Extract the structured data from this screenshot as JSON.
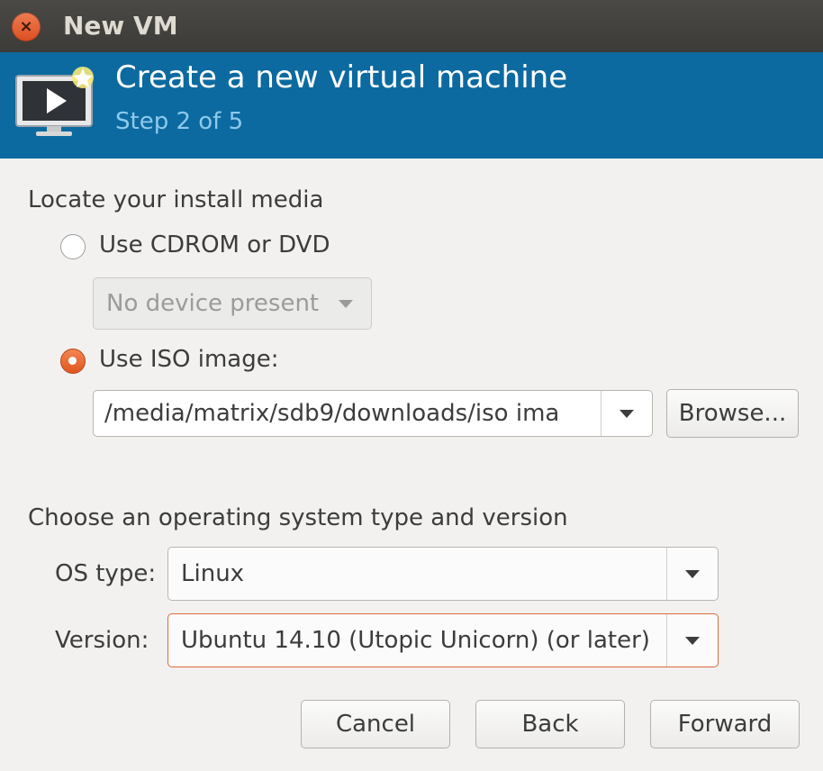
{
  "window": {
    "title": "New VM",
    "close_glyph": "×"
  },
  "header": {
    "title": "Create a new virtual machine",
    "step": "Step 2 of 5",
    "icon": "vm-monitor-icon"
  },
  "install_media": {
    "section_label": "Locate your install media",
    "cdrom": {
      "label": "Use CDROM or DVD",
      "selected": false,
      "device": "No device present"
    },
    "iso": {
      "label": "Use ISO image:",
      "selected": true,
      "path": "/media/matrix/sdb9/downloads/iso ima"
    },
    "browse_label": "Browse..."
  },
  "os": {
    "section_label": "Choose an operating system type and version",
    "type_label": "OS type:",
    "type_value": "Linux",
    "version_label": "Version:",
    "version_value": "Ubuntu 14.10 (Utopic Unicorn) (or later)"
  },
  "buttons": {
    "cancel": "Cancel",
    "back": "Back",
    "forward": "Forward"
  },
  "colors": {
    "header_bg": "#0c6aa0",
    "accent": "#e0561e"
  }
}
